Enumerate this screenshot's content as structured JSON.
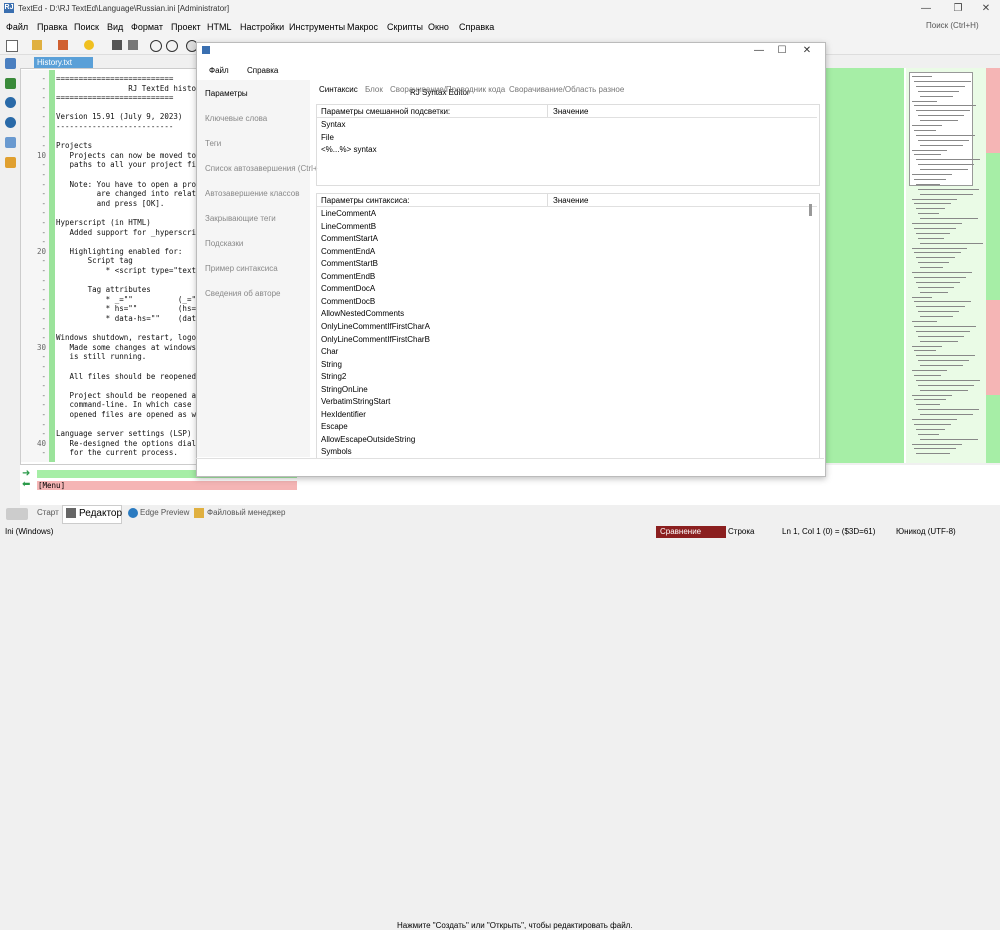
{
  "window": {
    "title": "TextEd - D:\\RJ TextEd\\Language\\Russian.ini [Administrator]",
    "logo": "RJ"
  },
  "menu": [
    "Файл",
    "Правка",
    "Поиск",
    "Вид",
    "Формат",
    "Проект",
    "HTML",
    "Настройки",
    "Инструменты",
    "Макрос",
    "Скрипты",
    "Окно",
    "Справка"
  ],
  "search": {
    "placeholder": "Поиск (Ctrl+H)"
  },
  "editor": {
    "tab_label": "History.txt",
    "lines": [
      {
        "num": "-",
        "text": "=========================="
      },
      {
        "num": "-",
        "text": "                RJ TextEd history"
      },
      {
        "num": "-",
        "text": "=========================="
      },
      {
        "num": "-",
        "text": ""
      },
      {
        "num": "-",
        "text": "Version 15.91 (July 9, 2023)"
      },
      {
        "num": "-",
        "text": "--------------------------"
      },
      {
        "num": "-",
        "text": ""
      },
      {
        "num": "-",
        "text": "Projects"
      },
      {
        "num": "10",
        "text": "   Projects can now be moved to"
      },
      {
        "num": "-",
        "text": "   paths to all your project fi"
      },
      {
        "num": "-",
        "text": ""
      },
      {
        "num": "-",
        "text": "   Note: You have to open a pro"
      },
      {
        "num": "-",
        "text": "         are changed into relat"
      },
      {
        "num": "-",
        "text": "         and press [OK]."
      },
      {
        "num": "-",
        "text": ""
      },
      {
        "num": "-",
        "text": "Hyperscript (in HTML)"
      },
      {
        "num": "-",
        "text": "   Added support for _hyperscri"
      },
      {
        "num": "-",
        "text": ""
      },
      {
        "num": "20",
        "text": "   Highlighting enabled for:"
      },
      {
        "num": "-",
        "text": "       Script tag"
      },
      {
        "num": "-",
        "text": "           * <script type=\"text"
      },
      {
        "num": "-",
        "text": ""
      },
      {
        "num": "-",
        "text": "       Tag attributes"
      },
      {
        "num": "-",
        "text": "           * _=\"\"          (_=\""
      },
      {
        "num": "-",
        "text": "           * hs=\"\"         (hs="
      },
      {
        "num": "-",
        "text": "           * data-hs=\"\"    (dat"
      },
      {
        "num": "-",
        "text": ""
      },
      {
        "num": "-",
        "text": "Windows shutdown, restart, logof"
      },
      {
        "num": "30",
        "text": "   Made some changes at windows"
      },
      {
        "num": "-",
        "text": "   is still running."
      },
      {
        "num": "-",
        "text": ""
      },
      {
        "num": "-",
        "text": "   All files should be reopened"
      },
      {
        "num": "-",
        "text": ""
      },
      {
        "num": "-",
        "text": "   Project should be reopened a"
      },
      {
        "num": "-",
        "text": "   command-line. In which case"
      },
      {
        "num": "-",
        "text": "   opened files are opened as w"
      },
      {
        "num": "-",
        "text": ""
      },
      {
        "num": "-",
        "text": "Language server settings (LSP)"
      },
      {
        "num": "40",
        "text": "   Re-designed the options dial"
      },
      {
        "num": "-",
        "text": "   for the current process."
      }
    ]
  },
  "bottom_pane": {
    "menu_line": "[Menu]"
  },
  "bottom_tabs": [
    "Старт",
    "Редактор",
    "Edge Preview",
    "Файловый менеджер"
  ],
  "statusbar": {
    "left": "Ini (Windows)",
    "compare": "Сравнение",
    "mode": "Строка",
    "position": "Ln 1, Col 1 (0) = ($3D=61)",
    "encoding": "Юникод (UTF-8)"
  },
  "dialog": {
    "title": "RJ Syntax Editor",
    "menu": [
      "Файл",
      "Справка"
    ],
    "nav": [
      "Параметры",
      "Ключевые слова",
      "Теги",
      "Список автозавершения (Ctrl+",
      "Автозавершение классов",
      "Закрывающие теги",
      "Подсказки",
      "Пример синтаксиса",
      "Сведения об авторе"
    ],
    "tabs": [
      "Синтаксис",
      "Блок",
      "Сворачивание/Проводник кода",
      "Сворачивание/Область разное"
    ],
    "mixed_panel": {
      "col1": "Параметры смешанной подсветки:",
      "col2": "Значение",
      "items": [
        "Syntax",
        "File",
        "<%...%> syntax"
      ]
    },
    "syntax_panel": {
      "col1": "Параметры синтаксиса:",
      "col2": "Значение",
      "items": [
        "LineCommentA",
        "LineCommentB",
        "CommentStartA",
        "CommentEndA",
        "CommentStartB",
        "CommentEndB",
        "CommentDocA",
        "CommentDocB",
        "AllowNestedComments",
        "OnlyLineCommentIfFirstCharA",
        "OnlyLineCommentIfFirstCharB",
        "Char",
        "String",
        "String2",
        "StringOnLine",
        "VerbatimStringStart",
        "HexIdentifier",
        "Escape",
        "AllowEscapeOutsideString",
        "Symbols"
      ]
    },
    "status": "Нажмите \"Создать\" или \"Открыть\", чтобы редактировать файл."
  }
}
